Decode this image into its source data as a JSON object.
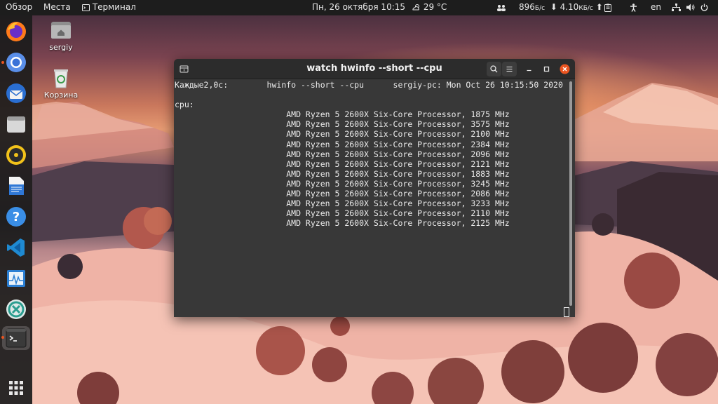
{
  "topbar": {
    "activities": "Обзор",
    "places": "Места",
    "terminal_app": "Терминал",
    "datetime": "Пн, 26 октября  10:15",
    "weather": "29 °C",
    "net_down_value": "896",
    "net_down_unit": "Б/с",
    "net_up_value": "4.10",
    "net_up_unit": "КБ/с",
    "keyboard_layout": "en"
  },
  "desktop": {
    "home_label": "sergiy",
    "trash_label": "Корзина"
  },
  "window": {
    "title": "watch hwinfo --short --cpu"
  },
  "terminal": {
    "lines": [
      "Каждые2,0с:        hwinfo --short --cpu      sergiy-pc: Mon Oct 26 10:15:50 2020",
      "",
      "cpu:",
      "                       AMD Ryzen 5 2600X Six-Core Processor, 1875 MHz",
      "                       AMD Ryzen 5 2600X Six-Core Processor, 3575 MHz",
      "                       AMD Ryzen 5 2600X Six-Core Processor, 2100 MHz",
      "                       AMD Ryzen 5 2600X Six-Core Processor, 2384 MHz",
      "                       AMD Ryzen 5 2600X Six-Core Processor, 2096 MHz",
      "                       AMD Ryzen 5 2600X Six-Core Processor, 2121 MHz",
      "                       AMD Ryzen 5 2600X Six-Core Processor, 1883 MHz",
      "                       AMD Ryzen 5 2600X Six-Core Processor, 3245 MHz",
      "                       AMD Ryzen 5 2600X Six-Core Processor, 2086 MHz",
      "                       AMD Ryzen 5 2600X Six-Core Processor, 3233 MHz",
      "                       AMD Ryzen 5 2600X Six-Core Processor, 2110 MHz",
      "                       AMD Ryzen 5 2600X Six-Core Processor, 2125 MHz"
    ]
  },
  "dock": {
    "apps": [
      "firefox-icon",
      "chromium-icon",
      "thunderbird-icon",
      "files-icon",
      "rhythmbox-icon",
      "writer-icon",
      "help-icon",
      "vscode-icon",
      "system-monitor-icon",
      "crossover-icon",
      "terminal-icon"
    ],
    "show_apps_icon": "apps-grid-icon"
  },
  "colors": {
    "accent": "#e95420",
    "terminal_bg": "#383838",
    "titlebar_bg": "#2c2c2c",
    "close_button": "#e95420"
  }
}
